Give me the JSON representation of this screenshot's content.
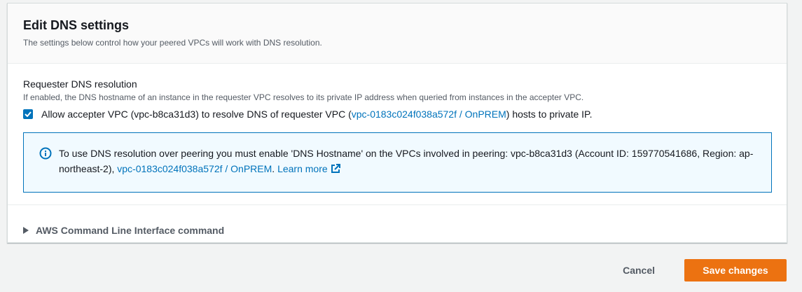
{
  "header": {
    "title": "Edit DNS settings",
    "description": "The settings below control how your peered VPCs will work with DNS resolution."
  },
  "requester": {
    "label": "Requester DNS resolution",
    "description": "If enabled, the DNS hostname of an instance in the requester VPC resolves to its private IP address when queried from instances in the accepter VPC.",
    "checked": true,
    "checkbox_text_pre": "Allow accepter VPC (vpc-b8ca31d3) to resolve DNS of requester VPC (",
    "checkbox_link": "vpc-0183c024f038a572f / OnPREM",
    "checkbox_text_post": ") hosts to private IP."
  },
  "info": {
    "text_pre": "To use DNS resolution over peering you must enable 'DNS Hostname' on the VPCs involved in peering: vpc-b8ca31d3 (Account ID: 159770541686, Region: ap-northeast-2), ",
    "vpc_link": "vpc-0183c024f038a572f / OnPREM",
    "text_mid": ". ",
    "learn_more": "Learn more"
  },
  "cli": {
    "label": "AWS Command Line Interface command"
  },
  "actions": {
    "cancel_label": "Cancel",
    "save_label": "Save changes"
  },
  "colors": {
    "accent": "#0073bb",
    "primary_button": "#ec7211",
    "info_background": "#f1faff"
  },
  "icons": [
    "checkmark-icon",
    "info-icon",
    "external-link-icon",
    "caret-right-icon"
  ]
}
